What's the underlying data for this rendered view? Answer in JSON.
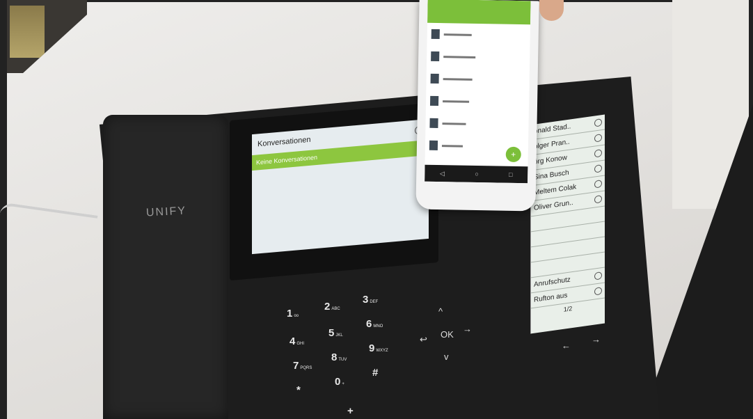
{
  "phone": {
    "brand": "UNIFY",
    "screen": {
      "title": "Konversationen",
      "row": "Keine Konversationen",
      "search_icon": "search-icon"
    },
    "side_panel": {
      "contacts": [
        "onald Stad..",
        "olger Pran..",
        "örg Konow",
        "Sina Busch",
        "Meltem Colak",
        "Oliver Grun.."
      ],
      "options": [
        "Anrufschutz",
        "Rufton aus"
      ],
      "pager": "1/2"
    },
    "keypad": [
      {
        "digit": "1",
        "sub": "oo"
      },
      {
        "digit": "2",
        "sub": "ABC"
      },
      {
        "digit": "3",
        "sub": "DEF"
      },
      {
        "digit": "4",
        "sub": "GHI"
      },
      {
        "digit": "5",
        "sub": "JKL"
      },
      {
        "digit": "6",
        "sub": "MNO"
      },
      {
        "digit": "7",
        "sub": "PQRS"
      },
      {
        "digit": "8",
        "sub": "TUV"
      },
      {
        "digit": "9",
        "sub": "WXYZ"
      },
      {
        "digit": "*",
        "sub": ""
      },
      {
        "digit": "0",
        "sub": "+"
      },
      {
        "digit": "#",
        "sub": ""
      }
    ],
    "nav": {
      "ok": "OK",
      "up": "^",
      "down": "v",
      "right": "→",
      "back": "↩"
    },
    "arrows": {
      "left": "←",
      "right": "→"
    },
    "plus": "+"
  },
  "mobile": {
    "fab": "+",
    "nav_icons": [
      "back-icon",
      "home-icon",
      "recents-icon"
    ]
  }
}
